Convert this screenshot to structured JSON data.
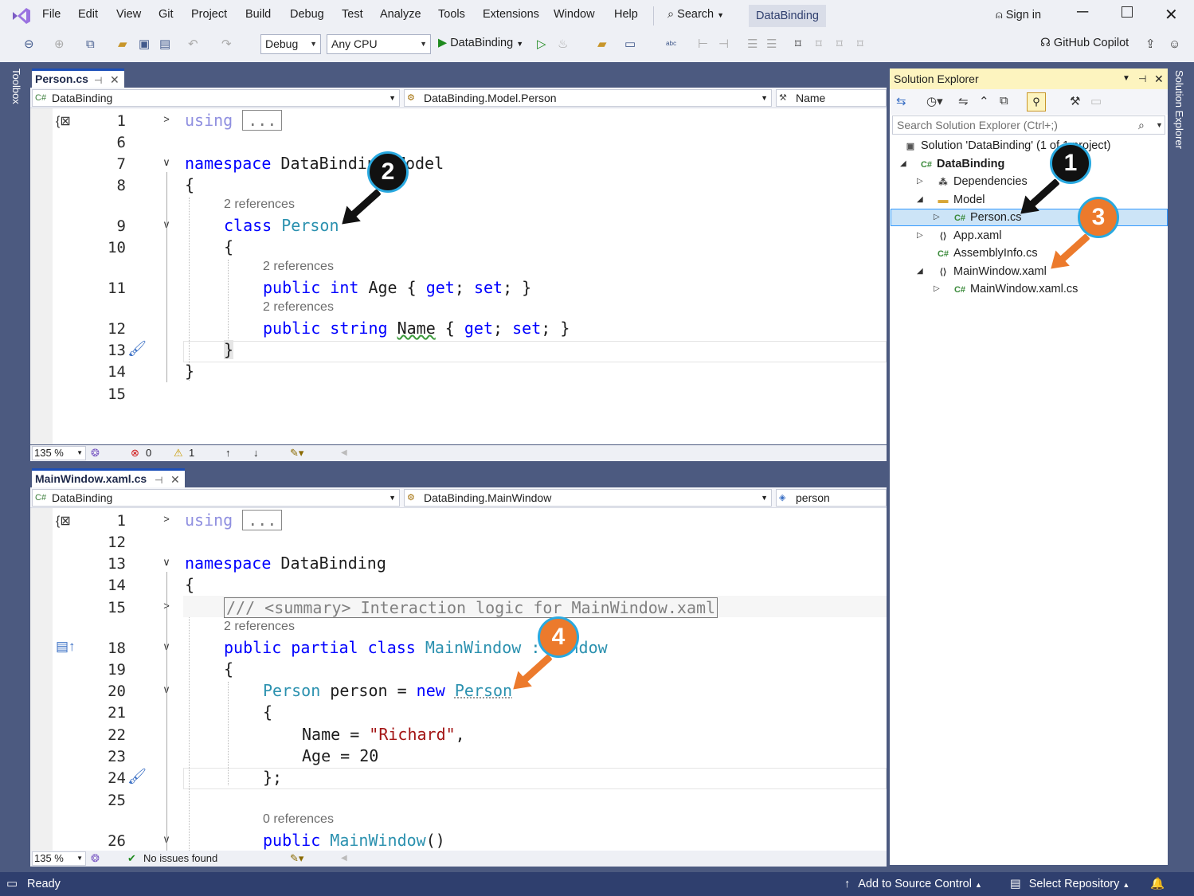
{
  "menu": [
    "File",
    "Edit",
    "View",
    "Git",
    "Project",
    "Build",
    "Debug",
    "Test",
    "Analyze",
    "Tools",
    "Extensions",
    "Window",
    "Help"
  ],
  "search_label": "Search",
  "solution_name_tab": "DataBinding",
  "sign_in": "Sign in",
  "toolbar": {
    "config": "Debug",
    "platform": "Any CPU",
    "start": "DataBinding",
    "copilot": "GitHub Copilot"
  },
  "toolbox_label": "Toolbox",
  "se_side_label": "Solution Explorer",
  "pane1": {
    "tab": "Person.cs",
    "nav_project": "DataBinding",
    "nav_type": "DataBinding.Model.Person",
    "nav_member": "Name",
    "zoom": "135 %",
    "errors": "0",
    "warnings": "1",
    "lines": [
      {
        "n": "1"
      },
      {
        "n": "6"
      },
      {
        "n": "7"
      },
      {
        "n": "8"
      },
      {
        "n": "9"
      },
      {
        "n": "10"
      },
      {
        "n": "11"
      },
      {
        "n": "12"
      },
      {
        "n": "13"
      },
      {
        "n": "14"
      },
      {
        "n": "15"
      }
    ],
    "code": {
      "l1_using": "using",
      "l1_dots": "...",
      "l7_ns": "namespace",
      "l7_name": "DataBinding.Model",
      "open": "{",
      "close": "}",
      "ref_class": "2 references",
      "l9_class": "class",
      "l9_name": "Person",
      "ref_age": "2 references",
      "l11_public": "public",
      "l11_int": "int",
      "l11_rest": "Age { ",
      "get": "get",
      "set": "set",
      "ref_name": "2 references",
      "l12_string": "string",
      "l12_name": "Name",
      "accessor_close": "; }",
      "semi": ";"
    }
  },
  "pane2": {
    "tab": "MainWindow.xaml.cs",
    "nav_project": "DataBinding",
    "nav_type": "DataBinding.MainWindow",
    "nav_member": "person",
    "zoom": "135 %",
    "status": "No issues found",
    "lines": [
      {
        "n": "1"
      },
      {
        "n": "12"
      },
      {
        "n": "13"
      },
      {
        "n": "14"
      },
      {
        "n": "15"
      },
      {
        "n": "18"
      },
      {
        "n": "19"
      },
      {
        "n": "20"
      },
      {
        "n": "21"
      },
      {
        "n": "22"
      },
      {
        "n": "23"
      },
      {
        "n": "24"
      },
      {
        "n": "25"
      },
      {
        "n": "26"
      }
    ],
    "code": {
      "l13_name": "DataBinding",
      "l15_summary": "/// <summary> Interaction logic for MainWindow.xaml",
      "ref_class": "2 references",
      "l18_kw": "public partial class",
      "l18_name": "MainWindow",
      "l18_base": ": Window",
      "l20_type": "Person",
      "l20_var": " person = ",
      "l20_new": "new",
      "l20_type2": "Person",
      "l22_name": "Name = ",
      "l22_str": "\"Richard\"",
      "l22_comma": ",",
      "l23": "Age = 20",
      "l24": "};",
      "ref_ctor": "0 references",
      "l26_public": "public",
      "l26_name": "MainWindow",
      "l26_paren": "()"
    }
  },
  "solution_explorer": {
    "title": "Solution Explorer",
    "search_placeholder": "Search Solution Explorer (Ctrl+;)",
    "items": [
      {
        "label": "Solution 'DataBinding' (1 of 1 project)"
      },
      {
        "label": "DataBinding"
      },
      {
        "label": "Dependencies"
      },
      {
        "label": "Model"
      },
      {
        "label": "Person.cs"
      },
      {
        "label": "App.xaml"
      },
      {
        "label": "AssemblyInfo.cs"
      },
      {
        "label": "MainWindow.xaml"
      },
      {
        "label": "MainWindow.xaml.cs"
      }
    ]
  },
  "callouts": [
    "1",
    "2",
    "3",
    "4"
  ],
  "status": {
    "ready": "Ready",
    "source_control": "Add to Source Control",
    "repo": "Select Repository"
  },
  "colors": {
    "accent": "#1c4fb8",
    "badge_black": "#111111",
    "badge_orange": "#ec7a2c",
    "badge_border": "#29a9e0",
    "statusbar": "#2f3f6e"
  }
}
